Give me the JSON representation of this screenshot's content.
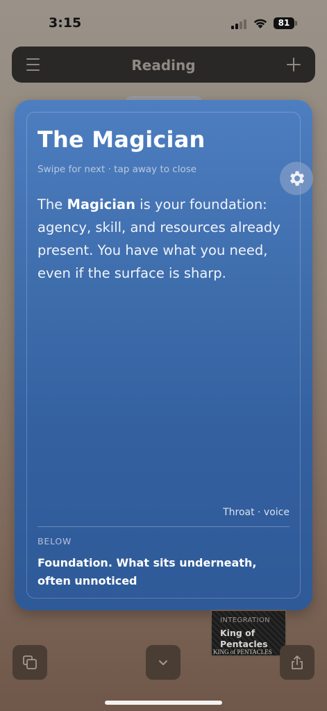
{
  "status_bar": {
    "time": "3:15",
    "battery": "81"
  },
  "nav": {
    "title": "Reading",
    "menu_icon": "hamburger-menu-icon",
    "add_icon": "plus-icon"
  },
  "card": {
    "title": "The Magician",
    "hint": "Swipe for next · tap away to close",
    "body_before": "The ",
    "body_bold": "Magician",
    "body_after": " is your foundation: agency, skill, and resources already present. You have what you need, even if the surface is sharp.",
    "tag": "Throat · voice",
    "section_label": "BELOW",
    "section_text": "Foundation. What sits underneath, often unnoticed",
    "colors": {
      "top": "#4d7ec0",
      "bottom": "#2f5a98"
    }
  },
  "settings_icon": "gear-icon",
  "mini_card": {
    "label": "INTEGRATION",
    "name": "King of Pentacles",
    "banner": "KING of PENTACLES"
  },
  "bottom_bar": {
    "left_icon": "copy-icon",
    "center_icon": "chevron-down-icon",
    "right_icon": "share-icon"
  }
}
